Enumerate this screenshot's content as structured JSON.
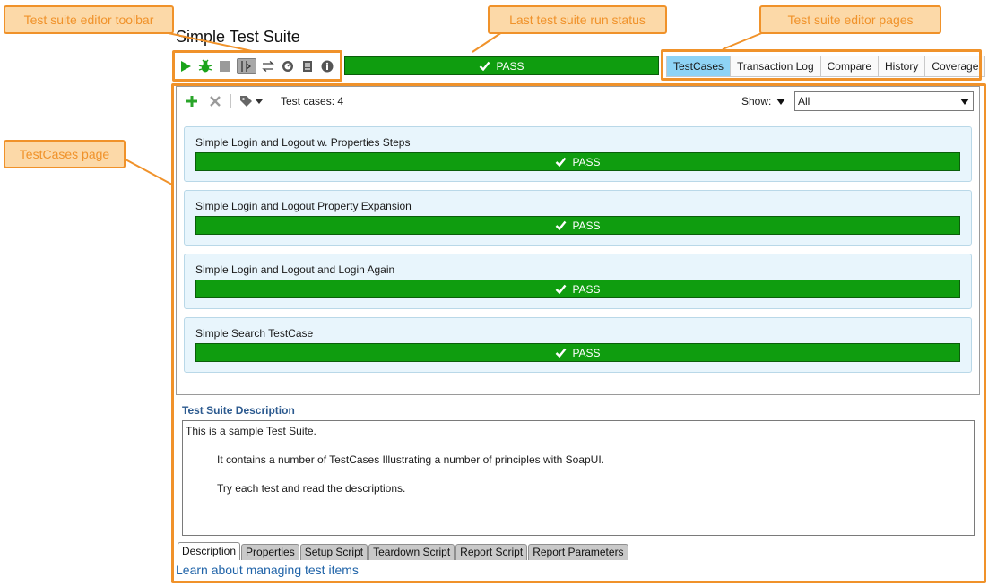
{
  "callouts": {
    "toolbar": "Test suite editor toolbar",
    "status": "Last test suite run status",
    "pages": "Test suite editor pages",
    "testcases_page": "TestCases page"
  },
  "colors": {
    "accent_orange": "#f0922a",
    "callout_fill": "#fcd9a8",
    "pass_green": "#0f9d0f",
    "active_tab": "#8ed3f5",
    "card_bg": "#e8f5fc",
    "link_blue": "#1f63a8"
  },
  "editor": {
    "title": "Simple Test Suite",
    "toolbar_icons": [
      "run-icon",
      "debug-icon",
      "stop-icon",
      "parallel-mode-icon",
      "sequential-mode-icon",
      "load-test-icon",
      "report-icon",
      "info-icon"
    ],
    "status": "PASS",
    "pages": [
      "TestCases",
      "Transaction Log",
      "Compare",
      "History",
      "Coverage"
    ],
    "active_page": "TestCases"
  },
  "testcases": {
    "count_label": "Test cases: 4",
    "show_label": "Show:",
    "show_value": "All",
    "items": [
      {
        "name": "Simple Login and Logout w. Properties Steps",
        "status": "PASS"
      },
      {
        "name": "Simple Login and Logout Property Expansion",
        "status": "PASS"
      },
      {
        "name": "Simple Login and Logout and Login Again",
        "status": "PASS"
      },
      {
        "name": "Simple Search TestCase",
        "status": "PASS"
      }
    ]
  },
  "description": {
    "title": "Test Suite Description",
    "lines": [
      "This is a sample Test Suite.",
      "It contains a number of TestCases Illustrating a number of principles with SoapUI.",
      "Try each test and read the descriptions."
    ]
  },
  "bottom_tabs": [
    "Description",
    "Properties",
    "Setup Script",
    "Teardown Script",
    "Report Script",
    "Report Parameters"
  ],
  "active_bottom_tab": "Description",
  "learn_link": "Learn about managing test items"
}
